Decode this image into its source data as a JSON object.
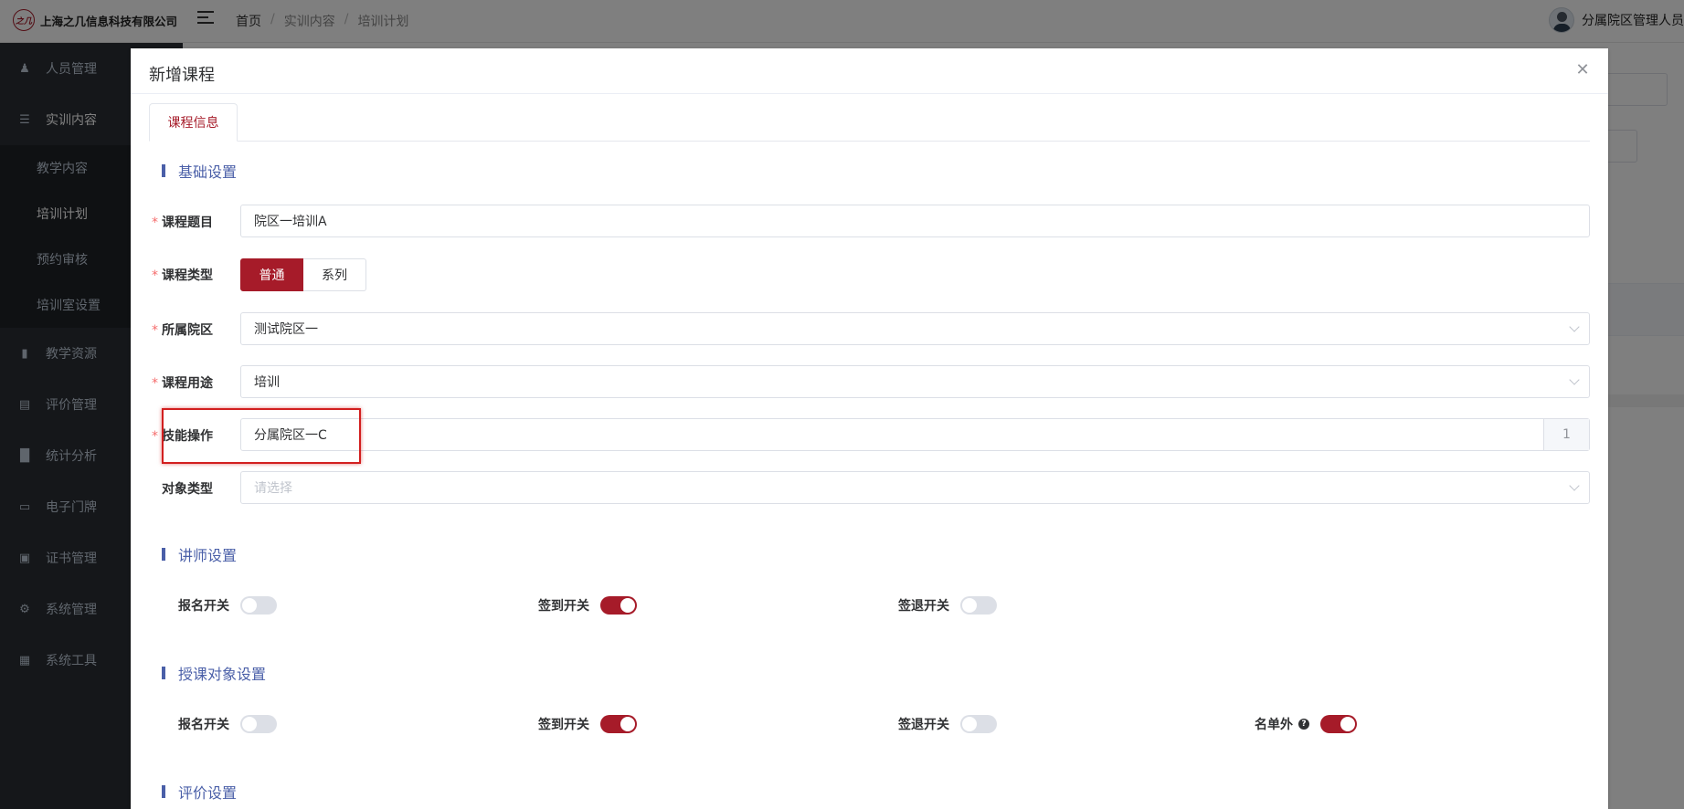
{
  "header": {
    "company": "上海之几信息科技有限公司",
    "logo_glyph": "之几",
    "breadcrumb": [
      "首页",
      "实训内容",
      "培训计划"
    ],
    "user_name": "分属院区管理人员"
  },
  "sidebar": {
    "items": [
      {
        "label": "人员管理",
        "icon": "users-icon"
      },
      {
        "label": "实训内容",
        "icon": "document-icon"
      },
      {
        "label": "教学资源",
        "icon": "book-icon"
      },
      {
        "label": "评价管理",
        "icon": "clipboard-icon"
      },
      {
        "label": "统计分析",
        "icon": "bar-chart-icon"
      },
      {
        "label": "电子门牌",
        "icon": "monitor-icon"
      },
      {
        "label": "证书管理",
        "icon": "certificate-icon"
      },
      {
        "label": "系统管理",
        "icon": "gear-icon"
      },
      {
        "label": "系统工具",
        "icon": "toolbox-icon"
      }
    ],
    "submenu": [
      "教学内容",
      "培训计划",
      "预约审核",
      "培训室设置"
    ],
    "active_submenu": "培训计划"
  },
  "dialog": {
    "title": "新增课程",
    "tab": "课程信息",
    "sections": {
      "basic": "基础设置",
      "lecturer": "讲师设置",
      "target": "授课对象设置",
      "evaluation": "评价设置"
    },
    "fields": {
      "course_title": {
        "label": "课程题目",
        "value": "院区一培训A"
      },
      "course_type": {
        "label": "课程类型",
        "options": [
          "普通",
          "系列"
        ],
        "selected": "普通"
      },
      "campus": {
        "label": "所属院区",
        "value": "测试院区一"
      },
      "purpose": {
        "label": "课程用途",
        "value": "培训"
      },
      "skill": {
        "label": "技能操作",
        "value": "分属院区一C",
        "count": "1"
      },
      "target_type": {
        "label": "对象类型",
        "placeholder": "请选择"
      }
    },
    "lecturer_switches": [
      {
        "label": "报名开关",
        "on": false
      },
      {
        "label": "签到开关",
        "on": true
      },
      {
        "label": "签退开关",
        "on": false
      }
    ],
    "target_switches": [
      {
        "label": "报名开关",
        "on": false
      },
      {
        "label": "签到开关",
        "on": true
      },
      {
        "label": "签退开关",
        "on": false
      },
      {
        "label": "名单外",
        "on": true,
        "help": "?"
      }
    ]
  },
  "colors": {
    "accent": "#a61b29",
    "section": "#4a5fa8",
    "sidebar": "#2a2e34",
    "highlight": "#d21f1f"
  }
}
